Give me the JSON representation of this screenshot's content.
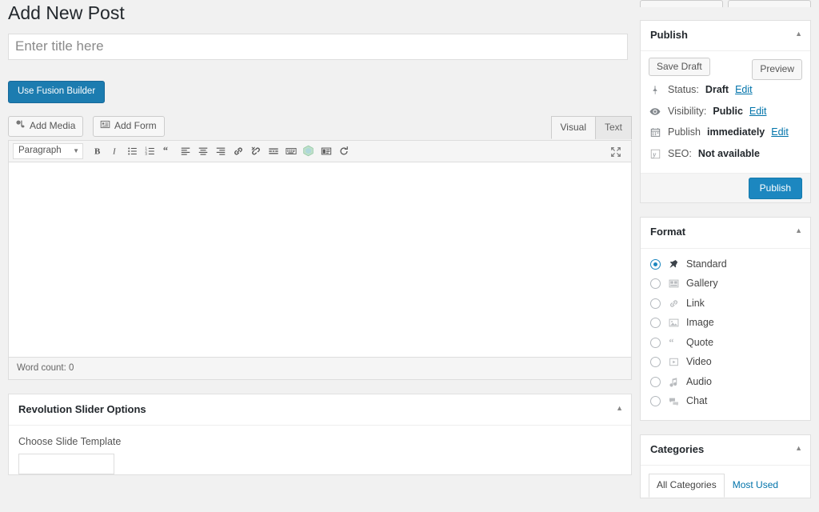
{
  "page": {
    "title": "Add New Post"
  },
  "title_field": {
    "placeholder": "Enter title here",
    "value": ""
  },
  "fusion": {
    "button_label": "Use Fusion Builder",
    "color": "#1c7cb0"
  },
  "editor": {
    "media_buttons": [
      {
        "label": "Add Media",
        "icon": "add-media-icon"
      },
      {
        "label": "Add Form",
        "icon": "add-form-icon"
      }
    ],
    "tabs": [
      {
        "label": "Visual",
        "active": true
      },
      {
        "label": "Text",
        "active": false
      }
    ],
    "format_select": {
      "value": "Paragraph"
    },
    "toolbar_buttons": [
      "bold-icon",
      "italic-icon",
      "bulleted-list-icon",
      "numbered-list-icon",
      "blockquote-icon",
      "align-left-icon",
      "align-center-icon",
      "align-right-icon",
      "insert-link-icon",
      "remove-link-icon",
      "read-more-icon",
      "keyboard-shortcuts-icon",
      "fusion-shortcodes-icon",
      "toolbar-toggle-icon",
      "undo-icon"
    ],
    "fullscreen_icon": "distraction-free-icon",
    "content": "",
    "word_count": "Word count: 0"
  },
  "slider_box": {
    "title": "Revolution Slider Options",
    "toggle_icon": "chevron-up-icon",
    "field_label": "Choose Slide Template",
    "select_value": ""
  },
  "publish_box": {
    "title": "Publish",
    "toggle_icon": "chevron-up-icon",
    "save_draft_label": "Save Draft",
    "preview_label": "Preview",
    "rows": [
      {
        "icon": "pin-icon",
        "label": "Status:",
        "value": "Draft",
        "edit": "Edit"
      },
      {
        "icon": "eye-icon",
        "label": "Visibility:",
        "value": "Public",
        "edit": "Edit"
      },
      {
        "icon": "calendar-icon",
        "label": "Publish",
        "value": "immediately",
        "edit": "Edit"
      },
      {
        "icon": "yoast-icon",
        "label": "SEO:",
        "value": "Not available",
        "edit": ""
      }
    ],
    "publish_label": "Publish",
    "publish_color": "#1c87c0"
  },
  "format_box": {
    "title": "Format",
    "toggle_icon": "chevron-up-icon",
    "options": [
      {
        "label": "Standard",
        "icon": "pin-icon",
        "selected": true
      },
      {
        "label": "Gallery",
        "icon": "gallery-icon",
        "selected": false
      },
      {
        "label": "Link",
        "icon": "link-icon",
        "selected": false
      },
      {
        "label": "Image",
        "icon": "image-icon",
        "selected": false
      },
      {
        "label": "Quote",
        "icon": "quote-icon",
        "selected": false
      },
      {
        "label": "Video",
        "icon": "video-icon",
        "selected": false
      },
      {
        "label": "Audio",
        "icon": "audio-icon",
        "selected": false
      },
      {
        "label": "Chat",
        "icon": "chat-icon",
        "selected": false
      }
    ]
  },
  "categories_box": {
    "title": "Categories",
    "toggle_icon": "chevron-up-icon",
    "tabs": [
      {
        "label": "All Categories",
        "active": true
      },
      {
        "label": "Most Used",
        "active": false
      }
    ]
  }
}
